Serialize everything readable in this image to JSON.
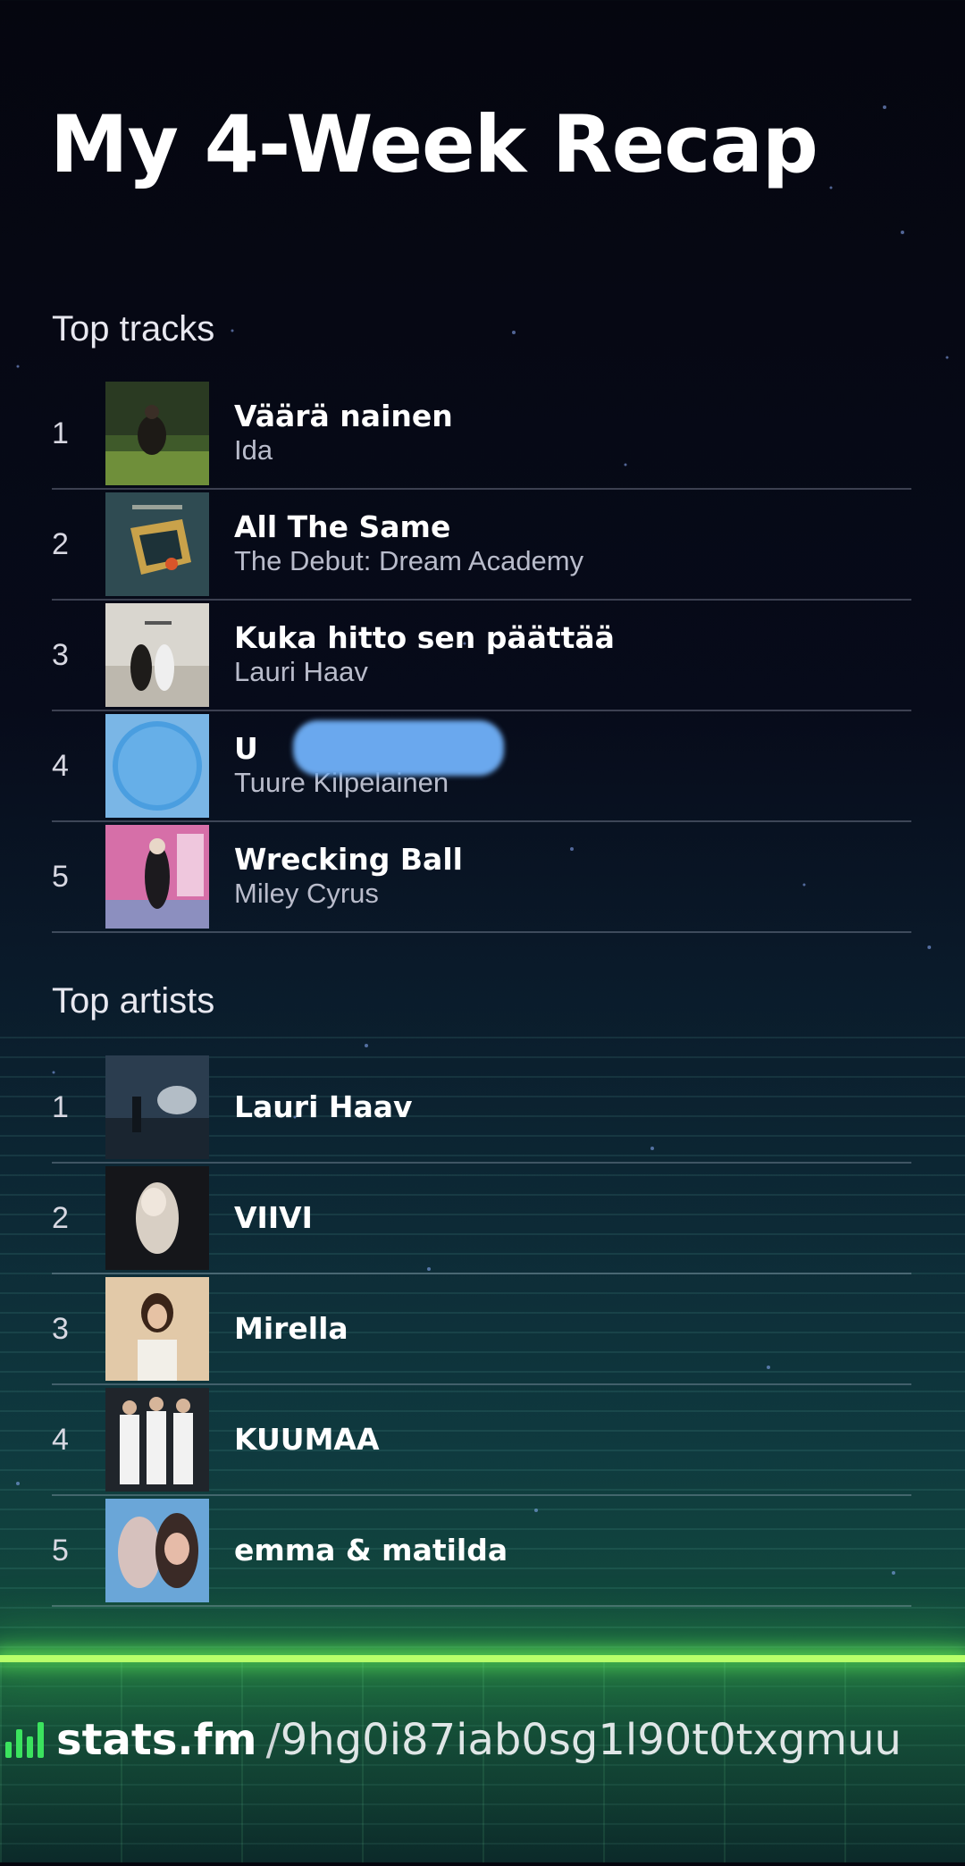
{
  "page": {
    "title": "My 4-Week Recap"
  },
  "top_tracks": {
    "heading": "Top tracks",
    "items": [
      {
        "rank": "1",
        "title": "Väärä nainen",
        "artist": "Ida"
      },
      {
        "rank": "2",
        "title": "All The Same",
        "artist": "The Debut: Dream Academy"
      },
      {
        "rank": "3",
        "title": "Kuka hitto sen päättää",
        "artist": "Lauri Haav"
      },
      {
        "rank": "4",
        "title": "U",
        "artist": "Tuure Kilpelainen"
      },
      {
        "rank": "5",
        "title": "Wrecking Ball",
        "artist": "Miley Cyrus"
      }
    ]
  },
  "top_artists": {
    "heading": "Top artists",
    "items": [
      {
        "rank": "1",
        "name": "Lauri Haav"
      },
      {
        "rank": "2",
        "name": "VIIVI"
      },
      {
        "rank": "3",
        "name": "Mirella"
      },
      {
        "rank": "4",
        "name": "KUUMAA"
      },
      {
        "rank": "5",
        "name": "emma & matilda"
      }
    ]
  },
  "footer": {
    "brand": "stats.fm",
    "separator": "/",
    "profile_code": "9hg0i87iab0sg1l90t0txgmuu"
  },
  "colors": {
    "brand_green": "#3be35e",
    "glow_line": "#b8ff6a",
    "redaction": "#6aa8ee"
  }
}
